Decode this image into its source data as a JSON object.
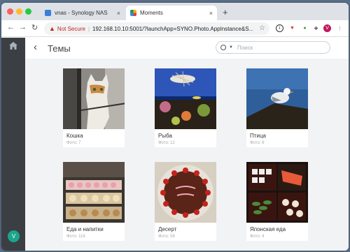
{
  "browser": {
    "tabs": [
      {
        "title": "vnas - Synology NAS",
        "favicon": "synology-icon",
        "close": "×"
      },
      {
        "title": "Moments",
        "favicon": "moments-icon",
        "close": "×"
      }
    ],
    "new_tab": "+",
    "nav": {
      "back": "←",
      "forward": "→",
      "reload": "↻"
    },
    "security": {
      "icon": "▲",
      "label": "Not Secure",
      "separator": "|"
    },
    "url": "192.168.10.10:5001/?launchApp=SYNO.Photo.AppInstance&S…",
    "bookmark_icon": "☆",
    "toolbar_icons": [
      {
        "name": "info-icon",
        "glyph": "i",
        "bg": "#ffffff",
        "fg": "#333333",
        "border": "#333333"
      },
      {
        "name": "extension-shield-icon",
        "glyph": "▼",
        "bg": "#ffffff",
        "fg": "#d93025",
        "border": "#ffffff"
      },
      {
        "name": "extension-green-icon",
        "glyph": "●",
        "bg": "#ffffff",
        "fg": "#3c9a3c",
        "border": "#ffffff"
      },
      {
        "name": "puzzle-icon",
        "glyph": "✚",
        "bg": "#ffffff",
        "fg": "#555555",
        "border": "#ffffff"
      },
      {
        "name": "profile-icon",
        "glyph": "V",
        "bg": "#c2185b",
        "fg": "#ffffff",
        "border": "#c2185b"
      },
      {
        "name": "menu-icon",
        "glyph": "⋮",
        "bg": "#ffffff",
        "fg": "#555555",
        "border": "#ffffff"
      }
    ]
  },
  "app": {
    "title": "Темы",
    "back_glyph": "‹",
    "search_placeholder": "Поиск",
    "avatar_letter": "V",
    "accent": "#1aa68a"
  },
  "topics": [
    {
      "name": "Кошка",
      "count": "Фото: 7",
      "image": "cat-photo"
    },
    {
      "name": "Рыба",
      "count": "Фото: 12",
      "image": "fish-photo"
    },
    {
      "name": "Птица",
      "count": "Фото: 6",
      "image": "bird-photo"
    },
    {
      "name": "Еда и напитки",
      "count": "Фото: 116",
      "image": "food-photo"
    },
    {
      "name": "Десерт",
      "count": "Фото: 58",
      "image": "dessert-photo"
    },
    {
      "name": "Японская еда",
      "count": "Фото: 4",
      "image": "japanese-food-photo"
    }
  ]
}
